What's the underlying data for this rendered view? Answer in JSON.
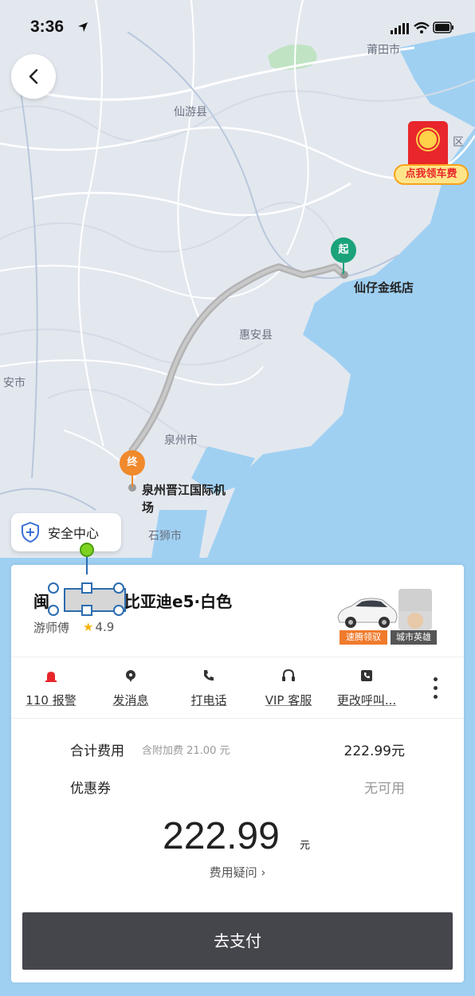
{
  "status_bar": {
    "time": "3:36"
  },
  "map": {
    "labels": {
      "putian": "莆田市",
      "xianyou": "仙游县",
      "qu": "区",
      "huian": "惠安县",
      "anshi": "安市",
      "quanzhou": "泉州市",
      "shishi": "石狮市"
    },
    "start_place": "仙仔金纸店",
    "end_place_line1": "泉州晋江国际机",
    "end_place_line2": "场",
    "start_marker_text": "起",
    "end_marker_text": "终"
  },
  "red_packet": {
    "label": "点我领车费"
  },
  "safety_center": {
    "label": "安全中心"
  },
  "driver": {
    "plate_prefix": "闽",
    "car_model": "比亚迪e5·白色",
    "name": "游师傅",
    "rating": "4.9",
    "badge_a": "速腾领驭",
    "badge_b": "城市英雄"
  },
  "actions": [
    {
      "label": "110 报警",
      "icon": "alarm-icon"
    },
    {
      "label": "发消息",
      "icon": "message-icon"
    },
    {
      "label": "打电话",
      "icon": "phone-icon"
    },
    {
      "label": "VIP 客服",
      "icon": "headset-icon"
    },
    {
      "label": "更改呼叫...",
      "icon": "call-change-icon"
    }
  ],
  "fees": {
    "total_label": "合计费用",
    "surcharge_note": "含附加费 21.00 元",
    "total_value": "222.99元",
    "coupon_label": "优惠券",
    "coupon_value": "无可用",
    "amount": "222.99",
    "unit": "元",
    "question": "费用疑问 ›"
  },
  "pay_button": "去支付",
  "colors": {
    "map_water": "#9fd0f2",
    "map_land": "#e3e8ef",
    "route": "#b3b3b3",
    "start_green": "#1aa37a",
    "end_orange": "#f08a2c",
    "pay_button": "#45464c"
  }
}
